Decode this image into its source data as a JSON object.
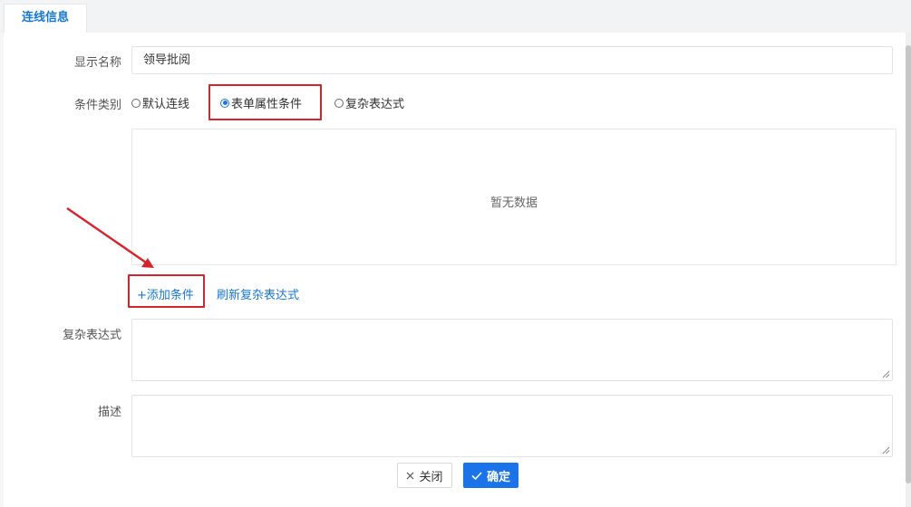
{
  "tabs": [
    {
      "label": "连线信息",
      "active": true
    }
  ],
  "form": {
    "display_name": {
      "label": "显示名称",
      "value": "领导批阅"
    },
    "condition_type": {
      "label": "条件类别",
      "options": [
        {
          "label": "默认连线",
          "checked": false
        },
        {
          "label": "表单属性条件",
          "checked": true
        },
        {
          "label": "复杂表达式",
          "checked": false
        }
      ]
    },
    "conditions_table": {
      "empty_text": "暂无数据"
    },
    "links": {
      "add_condition": "+添加条件",
      "refresh_expression": "刷新复杂表达式"
    },
    "complex_expression": {
      "label": "复杂表达式",
      "value": ""
    },
    "description": {
      "label": "描述",
      "value": ""
    }
  },
  "buttons": {
    "close": "关闭",
    "ok": "确定"
  },
  "colors": {
    "accent": "#1a73e8",
    "link": "#1677d2",
    "highlight": "#d9232a"
  }
}
